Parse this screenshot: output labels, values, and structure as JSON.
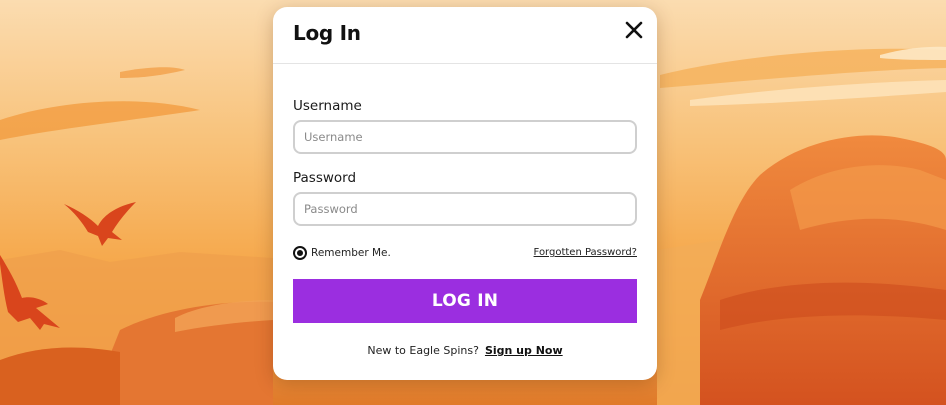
{
  "modal": {
    "title": "Log In",
    "close_icon": "close-icon"
  },
  "form": {
    "username": {
      "label": "Username",
      "placeholder": "Username",
      "value": ""
    },
    "password": {
      "label": "Password",
      "placeholder": "Password",
      "value": ""
    },
    "remember_label": "Remember Me.",
    "remember_checked": true,
    "forgot_label": "Forgotten Password?",
    "submit_label": "LOG IN"
  },
  "signup": {
    "prompt": "New to Eagle Spins?",
    "link_label": "Sign up Now"
  },
  "colors": {
    "accent": "#9b2ee0",
    "sky_top": "#f9d6a0",
    "sky_mid": "#f6a845",
    "rock": "#e0662a",
    "eagle": "#d9451c"
  }
}
